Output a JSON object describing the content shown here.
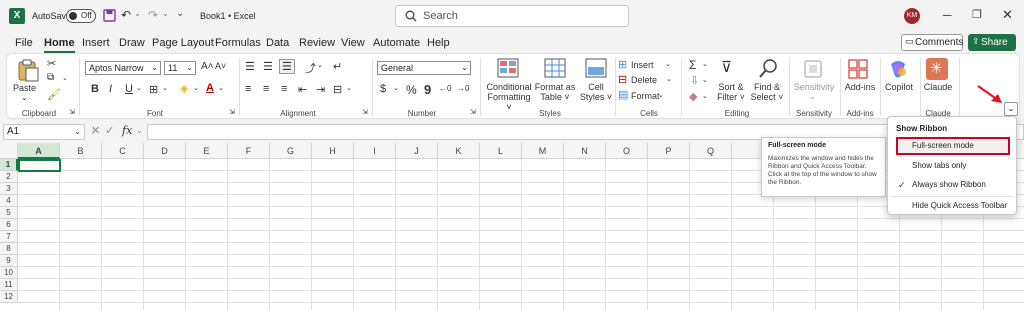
{
  "titlebar": {
    "app_icon": "X",
    "autosave_label": "AutoSave",
    "autosave_state": "Off",
    "doc_title": "Book1 • Excel",
    "search_placeholder": "Search",
    "user_initials": "KM"
  },
  "menu": [
    "File",
    "Home",
    "Insert",
    "Draw",
    "Page Layout",
    "Formulas",
    "Data",
    "Review",
    "View",
    "Automate",
    "Help"
  ],
  "active_tab": "Home",
  "actions": {
    "comments": "Comments",
    "share": "Share"
  },
  "ribbon": {
    "clipboard": {
      "paste": "Paste",
      "label": "Clipboard"
    },
    "font": {
      "name": "Aptos Narrow",
      "size": "11",
      "label": "Font",
      "grow": "A˄",
      "shrink": "A˅",
      "bold": "B",
      "italic": "I",
      "underline": "U"
    },
    "alignment": {
      "label": "Alignment"
    },
    "number": {
      "format": "General",
      "label": "Number",
      "percent": "%",
      "comma": "9"
    },
    "styles": {
      "conditional_1": "Conditional",
      "conditional_2": "Formatting ˅",
      "table_1": "Format as",
      "table_2": "Table ˅",
      "cell_1": "Cell",
      "cell_2": "Styles ˅",
      "label": "Styles"
    },
    "cells": {
      "insert": "Insert",
      "delete": "Delete",
      "format": "Format",
      "label": "Cells"
    },
    "editing": {
      "sigma": "Σ",
      "sort_1": "Sort &",
      "sort_2": "Filter ˅",
      "find_1": "Find &",
      "find_2": "Select ˅",
      "label": "Editing"
    },
    "sensitivity": {
      "button": "Sensitivity",
      "label": "Sensitivity"
    },
    "addins": {
      "button": "Add-ins",
      "label": "Add-ins"
    },
    "copilot": {
      "button": "Copilot"
    },
    "claude": {
      "button": "Claude",
      "label": "Claude"
    }
  },
  "formula_bar": {
    "name_box": "A1",
    "fx": "fx"
  },
  "columns": [
    "A",
    "B",
    "C",
    "D",
    "E",
    "F",
    "G",
    "H",
    "I",
    "J",
    "K",
    "L",
    "M",
    "N",
    "O",
    "P",
    "Q"
  ],
  "rows": [
    "1",
    "2",
    "3",
    "4",
    "5",
    "6",
    "7",
    "8",
    "9",
    "10",
    "11",
    "12"
  ],
  "tooltip": {
    "title": "Full-screen mode",
    "description": "Maximizes the window and hides the Ribbon and Quick Access Toolbar. Click at the top of the window to show the Ribbon."
  },
  "show_ribbon_menu": {
    "title": "Show Ribbon",
    "items": [
      "Full-screen mode",
      "Show tabs only",
      "Always show Ribbon",
      "Hide Quick Access Toolbar"
    ],
    "checked": "Always show Ribbon"
  },
  "colors": {
    "accent": "#1e7145",
    "highlight_box": "#d0021b",
    "arrow": "#e81123"
  },
  "icons": {
    "save": "save-icon",
    "undo": "undo-icon",
    "redo": "redo-icon",
    "search": "search-icon",
    "checkmark": "checkmark-icon",
    "collapse": "chevron-down-icon"
  }
}
